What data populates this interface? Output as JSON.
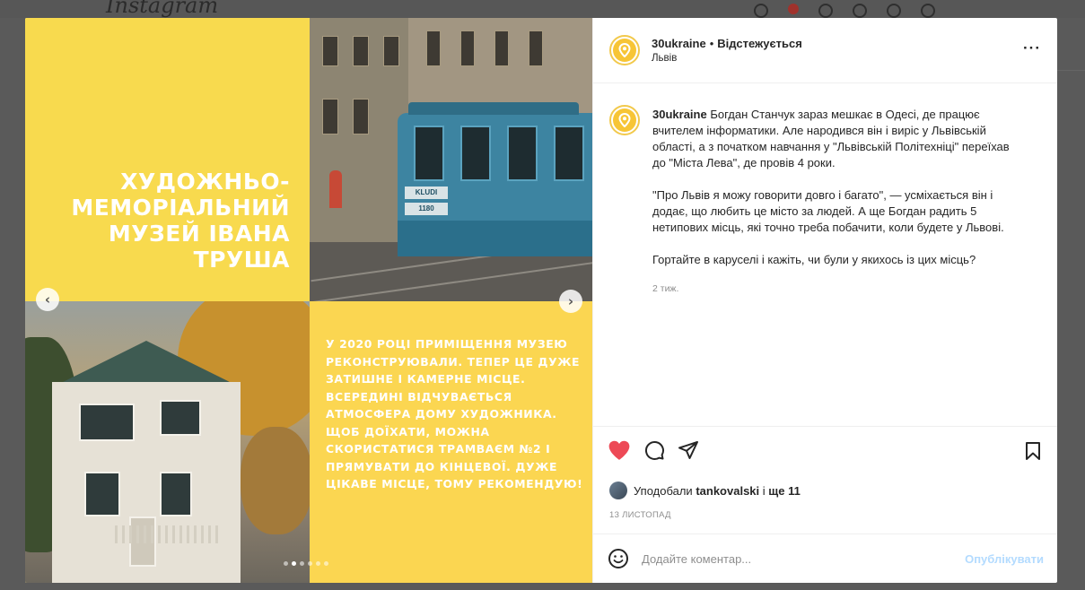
{
  "background": {
    "logo": "Instagram"
  },
  "post": {
    "header": {
      "username": "30ukraine",
      "separator": "•",
      "follow_status": "Відстежується",
      "location": "Львів",
      "more_label": "···"
    },
    "media": {
      "headline": "Художньо-меморіальний музей Івана Труша",
      "body_text": "У 2020 році приміщення музею реконструювали. Тепер це дуже затишне і камерне місце. Всередині відчувається атмосфера дому художника. Щоб доїхати, можна скористатися трамваєм №2 і прямувати до кінцевої. Дуже цікаве місце, тому рекомендую!",
      "tram_plate": "KLUDI",
      "tram_number": "1180",
      "prev_label": "‹",
      "next_label": "›",
      "dots_count": 6,
      "active_dot": 1
    },
    "caption": {
      "username": "30ukraine",
      "paragraphs": [
        "Богдан Станчук зараз мешкає в Одесі, де працює вчителем інформатики. Але народився він і виріс у Львівській області, а з початком навчання у \"Львівській Політехніці\" переїхав до \"Міста Лева\", де провів 4 роки.",
        "\"Про Львів я можу говорити довго і багато\", — усміхається він і додає, що любить це місто за людей. А ще Богдан радить 5 нетипових місць, які точно треба побачити, коли будете у Львові.",
        "Гортайте в каруселі і кажіть, чи були у якихось із цих місць?"
      ],
      "time_ago": "2 тиж."
    },
    "likes": {
      "prefix": "Уподобали",
      "user": "tankovalski",
      "middle": "і",
      "others": "ще 11"
    },
    "date": "13 ЛИСТОПАД",
    "comment": {
      "placeholder": "Додайте коментар...",
      "post_label": "Опублікувати"
    },
    "colors": {
      "like_red": "#ed4956",
      "yellow": "#f8da4e",
      "post_button": "#b3dbff"
    }
  }
}
